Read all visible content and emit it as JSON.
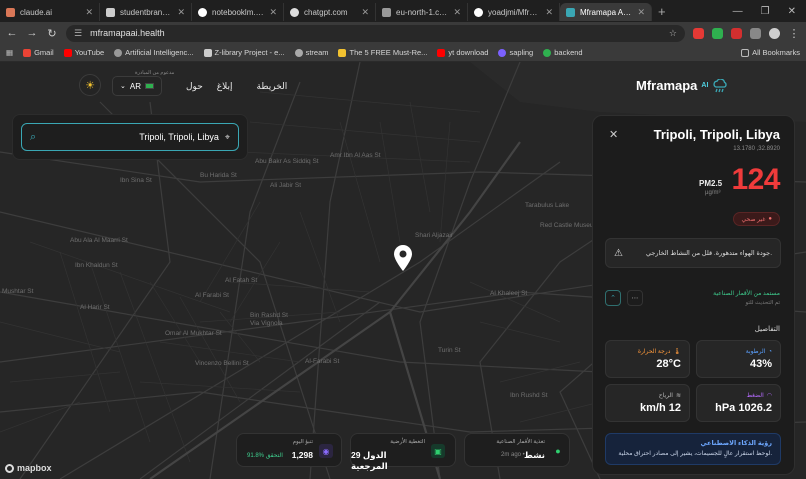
{
  "browser": {
    "tabs": [
      {
        "title": "claude.ai",
        "active": false
      },
      {
        "title": "studentbranches.ie",
        "active": false
      },
      {
        "title": "notebooklm.google.",
        "active": false
      },
      {
        "title": "chatgpt.com",
        "active": false
      },
      {
        "title": "eu-north-1.console.",
        "active": false
      },
      {
        "title": "yoadjmi/Mframapa-A",
        "active": false
      },
      {
        "title": "Mframapa AI - Satell",
        "active": true
      }
    ],
    "new_tab": "+",
    "url": "mframapaai.health",
    "bookmarks": [
      {
        "label": "Gmail",
        "color": "#ea4335"
      },
      {
        "label": "YouTube",
        "color": "#ff0000"
      },
      {
        "label": "Artificial Intelligenc...",
        "color": "#999999"
      },
      {
        "label": "Z-library Project - e...",
        "color": "#cccccc"
      },
      {
        "label": "stream",
        "color": "#aaaaaa"
      },
      {
        "label": "The 5 FREE Must-Re...",
        "color": "#f2c230"
      },
      {
        "label": "yt download",
        "color": "#ff0000"
      },
      {
        "label": "sapling",
        "color": "#7b61ff"
      },
      {
        "label": "backend",
        "color": "#2fb04f"
      }
    ],
    "all_bookmarks": "All Bookmarks"
  },
  "app": {
    "brand": "Mframapa",
    "brand_sup": "AI",
    "nav": [
      "الخريطة",
      "إبلاغ",
      "حول"
    ],
    "lang": "AR",
    "sponsored": "مدعوم من المبادرة",
    "search": {
      "value": "Tripoli, Tripoli, Libya"
    }
  },
  "panel": {
    "city": "Tripoli, Tripoli, Libya",
    "coords": "13.1780 ,32.8920",
    "aqi": "124",
    "pollutant": "PM2.5",
    "unit": "µg/m³",
    "health_status": "غير صحي",
    "advisory": "جودة الهواء متدهورة. قلل من النشاط الخارجي.",
    "source": "مستمد من الأقمار الصناعية",
    "source_sub": "تم التحديث للتو",
    "details_title": "التفاصيل",
    "cards": [
      {
        "label": "الرطوبة",
        "value": "43%",
        "color": "#5aa0ff"
      },
      {
        "label": "درجة الحرارة",
        "value": "28°C",
        "color": "#ff9a3c"
      },
      {
        "label": "الضغط",
        "value": "hPa 1026.2",
        "color": "#b56bff"
      },
      {
        "label": "الرياح",
        "value": "km/h 12",
        "color": "#aaaaaa"
      }
    ],
    "ai_title": "رؤية الذكاء الاصطناعي",
    "ai_text": "لوحظ استقرار عالٍ للجسيمات، يشير إلى مصادر احتراق محلية."
  },
  "stats": [
    {
      "title": "تغذية الأقمار الصناعية",
      "value": "نشط",
      "extra": "2m ago •",
      "icon_color": "#2fcf6f"
    },
    {
      "title": "التغطية الأرضية",
      "value": "29 الدول المرجعية",
      "extra": "",
      "icon_color": "#2fcf6f"
    },
    {
      "title": "تنبؤ اليوم",
      "value": "1,298",
      "extra": "91.8% التحقق",
      "icon_color": "#8a6bff"
    }
  ],
  "map": {
    "attribution": "mapbox",
    "streets": [
      "Ibn Sina St",
      "Abu Bakr As Siddiq St",
      "Bu Harida St",
      "Amr Ibn Al Aas St",
      "Ali Jabir St",
      "Abu Ala Al Maarri St",
      "Al Farabi St",
      "Bin Rashd St",
      "Al Harir St",
      "Vincenzo Bellini St",
      "Al-Farabi St",
      "Turin St",
      "Via Vignola",
      "Mushtar St",
      "Al Fatah St",
      "Omar Al Mukhtar St",
      "Ibn Khaldun St",
      "Shari Aljazair",
      "Red Castle Museum",
      "Tarabulus Lake",
      "Al Khaleej St",
      "Ibn Rushd St"
    ]
  }
}
